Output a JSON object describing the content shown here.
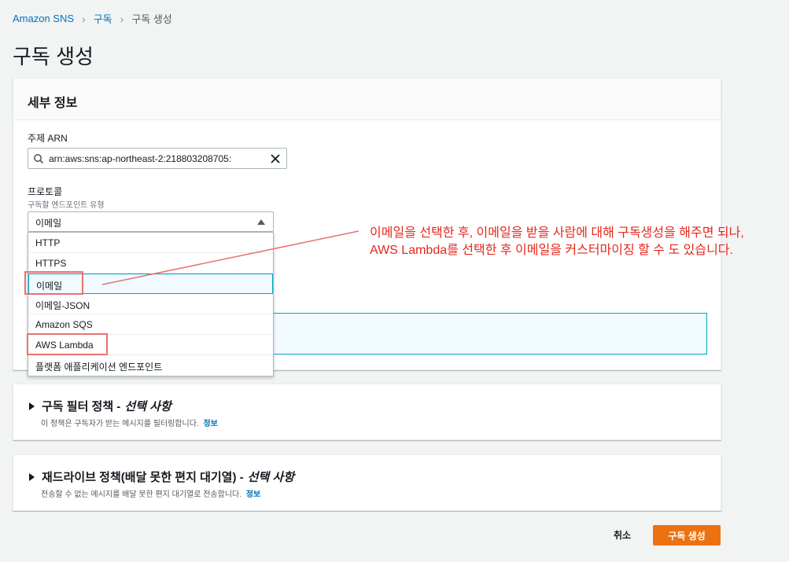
{
  "breadcrumb": {
    "root": "Amazon SNS",
    "level1": "구독",
    "current": "구독 생성"
  },
  "page_title": "구독 생성",
  "details": {
    "header": "세부 정보",
    "topic_arn_label": "주제 ARN",
    "topic_arn_value": "arn:aws:sns:ap-northeast-2:218803208705:",
    "protocol_label": "프로토콜",
    "protocol_desc": "구독할 엔드포인트 유형",
    "protocol_selected": "이메일",
    "protocol_options": [
      "HTTP",
      "HTTPS",
      "이메일",
      "이메일-JSON",
      "Amazon SQS",
      "AWS Lambda",
      "플랫폼 애플리케이션 엔드포인트"
    ]
  },
  "filter_policy": {
    "title": "구독 필터 정책 -",
    "optional": "선택 사항",
    "desc": "이 정책은 구독자가 받는 메시지를 필터링합니다.",
    "info": "정보"
  },
  "dlq_policy": {
    "title": "재드라이브 정책(배달 못한 편지 대기열) -",
    "optional": "선택 사항",
    "desc": "전송할 수 없는 메시지를 배달 못한 편지 대기열로 전송합니다.",
    "info": "정보"
  },
  "actions": {
    "cancel": "취소",
    "create": "구독 생성"
  },
  "annotation": {
    "line1": "이메일을 선택한 후, 이메일을 받을 사람에 대해 구독생성을 해주면 되나,",
    "line2": "AWS Lambda를 선택한 후 이메일을 커스터마이징 할 수 도 있습니다.",
    "color": "#e5271c"
  },
  "colors": {
    "link": "#0073bb",
    "primary_button": "#ec7211",
    "annotation_box": "#e8736d"
  }
}
